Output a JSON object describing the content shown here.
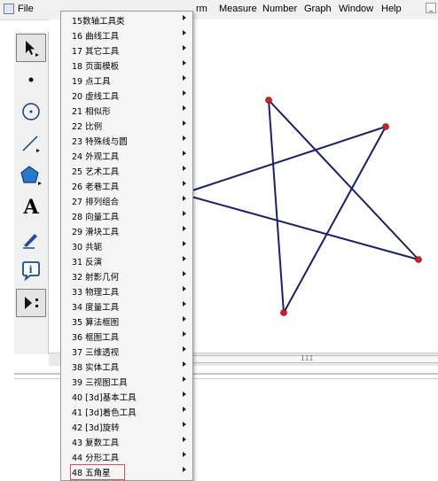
{
  "menubar": {
    "items": [
      "File",
      "rm",
      "Measure",
      "Number",
      "Graph",
      "Window",
      "Help"
    ],
    "win_button": "_"
  },
  "toolbox": {
    "tools": [
      "arrow-select-tool",
      "point-tool",
      "compass-tool",
      "straightedge-tool",
      "polygon-tool",
      "text-tool",
      "marker-tool",
      "information-tool",
      "custom-tools"
    ],
    "text_tool_glyph": "A",
    "info_glyph": "i"
  },
  "scrollbar": {
    "grip": "III"
  },
  "submenu": {
    "items": [
      {
        "label": "15数轴工具类"
      },
      {
        "label": "16 曲线工具"
      },
      {
        "label": "17 其它工具"
      },
      {
        "label": "18 页面模板"
      },
      {
        "label": "19 点工具"
      },
      {
        "label": "20 虚线工具"
      },
      {
        "label": "21 相似形"
      },
      {
        "label": "22 比例"
      },
      {
        "label": "23 特殊线与圆"
      },
      {
        "label": "24 外观工具"
      },
      {
        "label": "25 艺术工具"
      },
      {
        "label": "26 老巷工具"
      },
      {
        "label": "27 排列组合"
      },
      {
        "label": "28 向量工具"
      },
      {
        "label": "29 滑块工具"
      },
      {
        "label": "30 共轭"
      },
      {
        "label": "31 反演"
      },
      {
        "label": "32 射影几何"
      },
      {
        "label": "33 物理工具"
      },
      {
        "label": "34 度量工具"
      },
      {
        "label": "35 算法框图"
      },
      {
        "label": "36 框图工具"
      },
      {
        "label": "37 三维透视"
      },
      {
        "label": "38 实体工具"
      },
      {
        "label": "39 三视图工具"
      },
      {
        "label": "40 [3d]基本工具"
      },
      {
        "label": "41 [3d]着色工具"
      },
      {
        "label": "42 [3d]旋转"
      },
      {
        "label": "43 复数工具"
      },
      {
        "label": "44 分形工具"
      },
      {
        "label": "48 五角星"
      }
    ],
    "highlighted_index": 30
  },
  "figure": {
    "stroke_color": "#1a1f6e",
    "point_color": "#d42020"
  },
  "colors": {
    "submenu_bg": "#f5f5f5",
    "highlight_box": "#d9534f"
  }
}
